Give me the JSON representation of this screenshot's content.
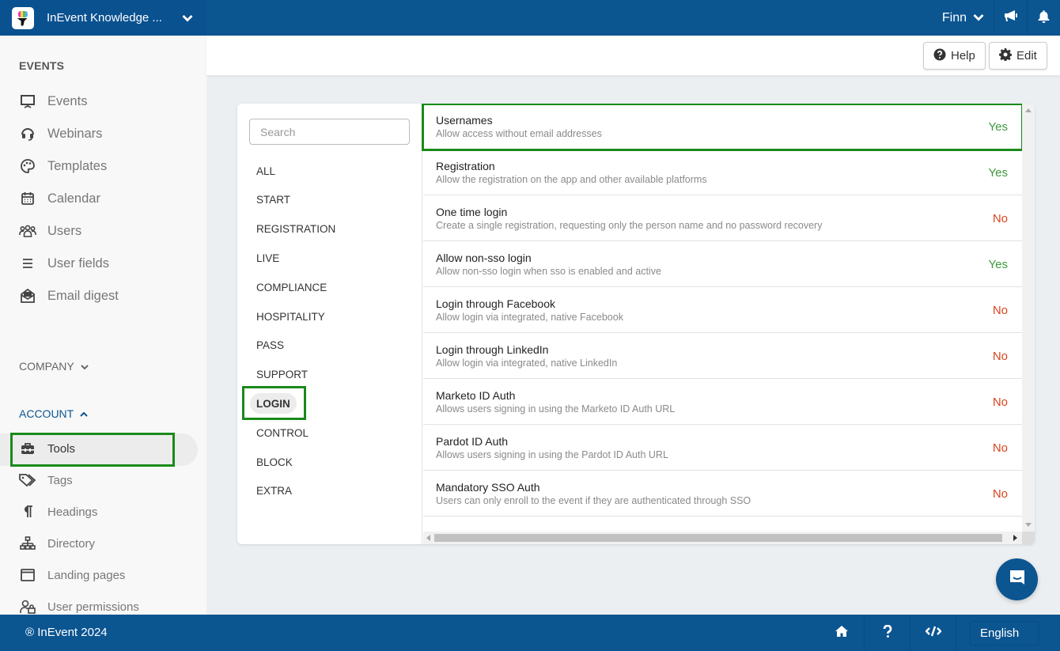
{
  "app": {
    "title": "InEvent Knowledge ...",
    "user_name": "Finn"
  },
  "header": {
    "help_label": "Help",
    "edit_label": "Edit"
  },
  "sidebar": {
    "events_title": "EVENTS",
    "events_items": [
      {
        "label": "Events",
        "icon": "presentation-board-icon"
      },
      {
        "label": "Webinars",
        "icon": "headset-icon"
      },
      {
        "label": "Templates",
        "icon": "palette-icon"
      },
      {
        "label": "Calendar",
        "icon": "calendar-icon"
      },
      {
        "label": "Users",
        "icon": "users-icon"
      },
      {
        "label": "User fields",
        "icon": "list-icon"
      },
      {
        "label": "Email digest",
        "icon": "envelope-open-icon"
      }
    ],
    "company_title": "COMPANY",
    "account_title": "ACCOUNT",
    "account_items": [
      {
        "label": "Tools",
        "icon": "toolbox-icon",
        "selected": true
      },
      {
        "label": "Tags",
        "icon": "tags-icon"
      },
      {
        "label": "Headings",
        "icon": "paragraph-icon"
      },
      {
        "label": "Directory",
        "icon": "sitemap-icon"
      },
      {
        "label": "Landing pages",
        "icon": "window-icon"
      },
      {
        "label": "User permissions",
        "icon": "user-lock-icon"
      }
    ]
  },
  "tools": {
    "search_placeholder": "Search",
    "search_value": "",
    "categories": [
      "ALL",
      "START",
      "REGISTRATION",
      "LIVE",
      "COMPLIANCE",
      "HOSPITALITY",
      "PASS",
      "SUPPORT",
      "LOGIN",
      "CONTROL",
      "BLOCK",
      "EXTRA"
    ],
    "active_category": "LOGIN",
    "settings": [
      {
        "name": "Usernames",
        "description": "Allow access without email addresses",
        "value": "Yes"
      },
      {
        "name": "Registration",
        "description": "Allow the registration on the app and other available platforms",
        "value": "Yes"
      },
      {
        "name": "One time login",
        "description": "Create a single registration, requesting only the person name and no password recovery",
        "value": "No"
      },
      {
        "name": "Allow non-sso login",
        "description": "Allow non-sso login when sso is enabled and active",
        "value": "Yes"
      },
      {
        "name": "Login through Facebook",
        "description": "Allow login via integrated, native Facebook",
        "value": "No"
      },
      {
        "name": "Login through LinkedIn",
        "description": "Allow login via integrated, native LinkedIn",
        "value": "No"
      },
      {
        "name": "Marketo ID Auth",
        "description": "Allows users signing in using the Marketo ID Auth URL",
        "value": "No"
      },
      {
        "name": "Pardot ID Auth",
        "description": "Allows users signing in using the Pardot ID Auth URL",
        "value": "No"
      },
      {
        "name": "Mandatory SSO Auth",
        "description": "Users can only enroll to the event if they are authenticated through SSO",
        "value": "No"
      }
    ]
  },
  "footer": {
    "copyright": "® InEvent 2024",
    "language": "English"
  },
  "colors": {
    "brand": "#0b5591",
    "yes": "#3d9a3d",
    "no": "#d9441d",
    "highlight": "#1a8a1a"
  }
}
